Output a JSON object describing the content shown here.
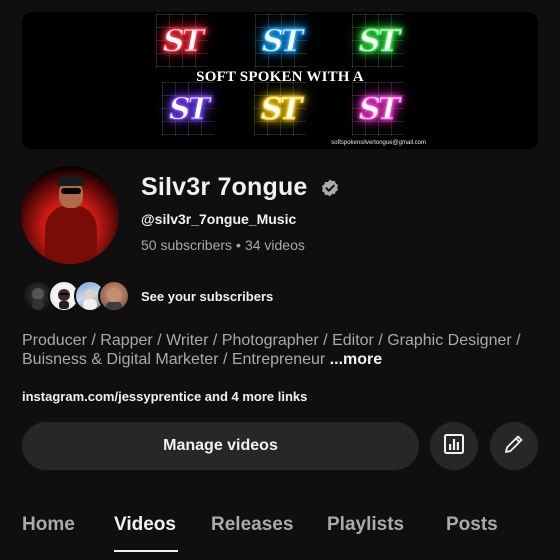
{
  "banner": {
    "logo_text": "ST",
    "logo_colors": [
      "#ff3344",
      "#1fa4ff",
      "#35e84a",
      "#7a45ff",
      "#ffd21f",
      "#ff3fd8"
    ],
    "caption": "SOFT SPOKEN WITH A",
    "email": "softspokensilvertongue@gmail.com"
  },
  "channel": {
    "name": "Silv3r 7ongue",
    "verified_icon": "verified-badge-icon",
    "handle": "@silv3r_7ongue_Music",
    "subscribers": "50 subscribers",
    "separator": "•",
    "videos": "34 videos"
  },
  "subscribers_row": {
    "label": "See your subscribers"
  },
  "description": {
    "text": "Producer / Rapper / Writer / Photographer / Editor / Graphic Designer / Buisness & Digital Marketer / Entrepreneur",
    "more": "...more"
  },
  "links": {
    "text": "instagram.com/jessyprentice and 4 more links"
  },
  "actions": {
    "manage_label": "Manage videos",
    "analytics_icon": "analytics-icon",
    "edit_icon": "pencil-icon"
  },
  "tabs": [
    {
      "label": "Home",
      "active": false
    },
    {
      "label": "Videos",
      "active": true
    },
    {
      "label": "Releases",
      "active": false
    },
    {
      "label": "Playlists",
      "active": false
    },
    {
      "label": "Posts",
      "active": false
    }
  ],
  "colors": {
    "background": "#0f0f0f",
    "button": "#272727",
    "text_primary": "#f1f1f1",
    "text_secondary": "#aaaaaa"
  }
}
